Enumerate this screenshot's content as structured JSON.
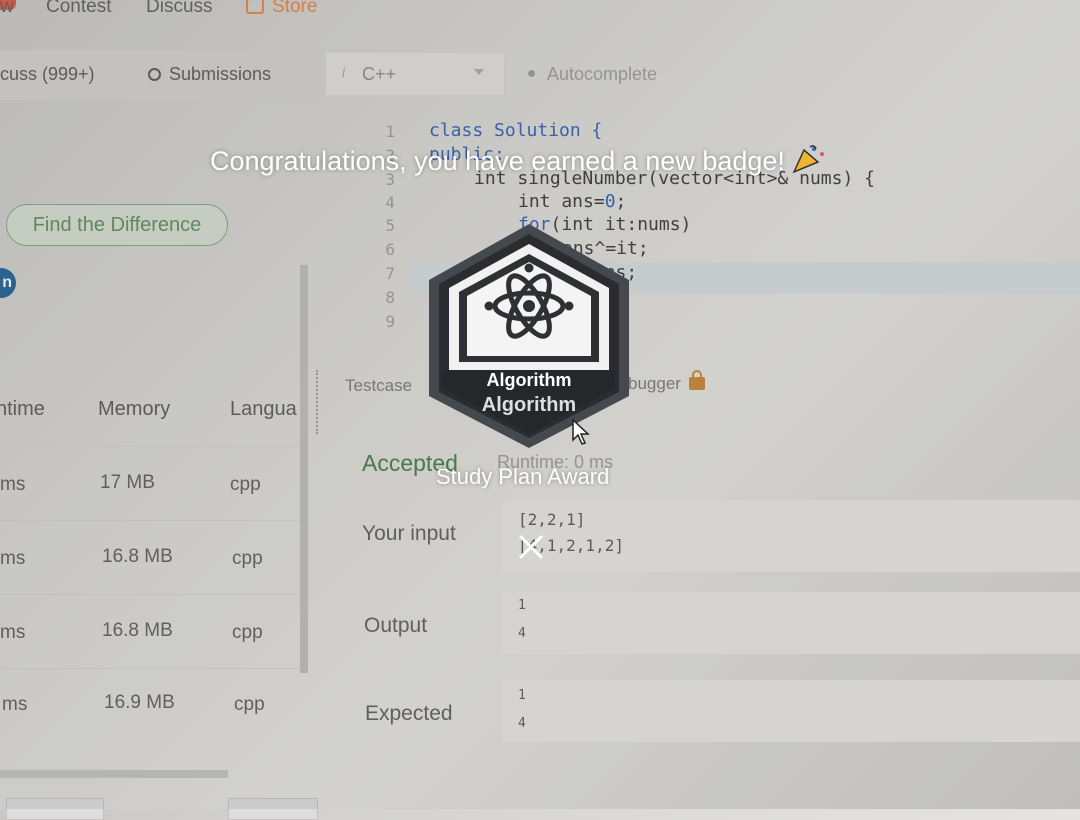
{
  "nav": {
    "item0": "w",
    "contest": "Contest",
    "discuss": "Discuss",
    "store": "Store"
  },
  "tabs": {
    "discuss": "cuss (999+)",
    "submissions": "Submissions"
  },
  "editor": {
    "language": "C++",
    "autocomplete": "Autocomplete",
    "line_numbers": [
      "1",
      "2",
      "3",
      "4",
      "5",
      "6",
      "7",
      "8",
      "9"
    ],
    "code": {
      "line1_kw": "class",
      "line1_rest": " Solution {",
      "line2": "public:",
      "line3": "int singleNumber(vector<int>& nums) {",
      "line4_a": "int ans=",
      "line4_b": "0",
      "line4_c": ";",
      "line5_a": "for",
      "line5_b": "(int it:nums)",
      "line6": "ans^=it;",
      "line7": "return ans;"
    }
  },
  "left_panel": {
    "tag": "Find the Difference",
    "avatar_letter": "n",
    "columns": [
      "ntime",
      "Memory",
      "Langua"
    ],
    "rows": [
      {
        "runtime": "ms",
        "memory": "17 MB",
        "language": "cpp"
      },
      {
        "runtime": "ms",
        "memory": "16.8 MB",
        "language": "cpp"
      },
      {
        "runtime": "ms",
        "memory": "16.8 MB",
        "language": "cpp"
      },
      {
        "runtime": "ms",
        "memory": "16.9 MB",
        "language": "cpp"
      }
    ]
  },
  "console": {
    "testcase_tab": "Testcase",
    "debugger_tab": "bugger",
    "status": "Accepted",
    "runtime": "Runtime: 0 ms",
    "your_input_label": "Your input",
    "input_lines": [
      "[2,2,1]",
      "[4,1,2,1,2]"
    ],
    "output_label": "Output",
    "output_lines": [
      "1",
      "4"
    ],
    "expected_label": "Expected",
    "expected_lines": [
      "1",
      "4"
    ]
  },
  "overlay": {
    "message": "Congratulations, you have earned a new badge!",
    "badge_name": "Algorithm",
    "badge_name_ghost": "Algorithm",
    "award": "Study Plan Award",
    "icons": {
      "badge_symbol": "atom-icon",
      "celebration": "party-popper-icon",
      "dismiss": "close-icon"
    }
  },
  "colors": {
    "accepted": "#3d7a3d",
    "keyword": "#2d5bb5",
    "store": "#e7833b",
    "badge_dark": "#2e3033",
    "badge_ring": "#4a4d52"
  }
}
